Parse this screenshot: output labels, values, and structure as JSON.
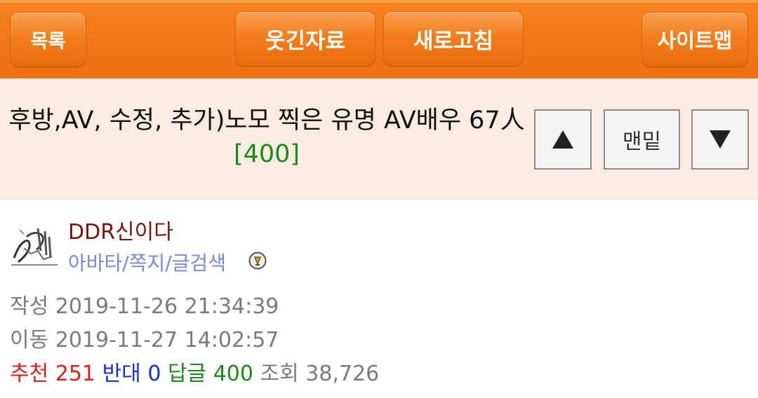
{
  "nav": {
    "list": "목록",
    "humor": "웃긴자료",
    "refresh": "새로고침",
    "sitemap": "사이트맵"
  },
  "post": {
    "title": "후방,AV, 수정, 추가)노모 찍은 유명 AV배우 67人",
    "comment_count": "[400]",
    "up_icon": "triangle-up",
    "bottom_label": "맨밑",
    "down_icon": "triangle-down"
  },
  "author": {
    "nickname": "DDR신이다",
    "tools_label": "아바타/쪽지/글검색",
    "avatar_icon": "sketch-avatar",
    "badge_icon": "level-badge"
  },
  "meta": {
    "written_label": "작성",
    "written_value": "2019-11-26 21:34:39",
    "moved_label": "이동",
    "moved_value": "2019-11-27 14:02:57",
    "recommend_label": "추천",
    "recommend_value": "251",
    "oppose_label": "반대",
    "oppose_value": "0",
    "reply_label": "답글",
    "reply_value": "400",
    "views_label": "조회",
    "views_value": "38,726"
  },
  "colors": {
    "nav_orange": "#f37e1d",
    "title_band": "#fbebe0",
    "nickname": "#7a1212",
    "tools": "#7b86df",
    "recommend": "#e01e1e",
    "oppose": "#1a2ec9",
    "reply": "#1a8a1a",
    "meta_gray": "#7b7b7b"
  }
}
